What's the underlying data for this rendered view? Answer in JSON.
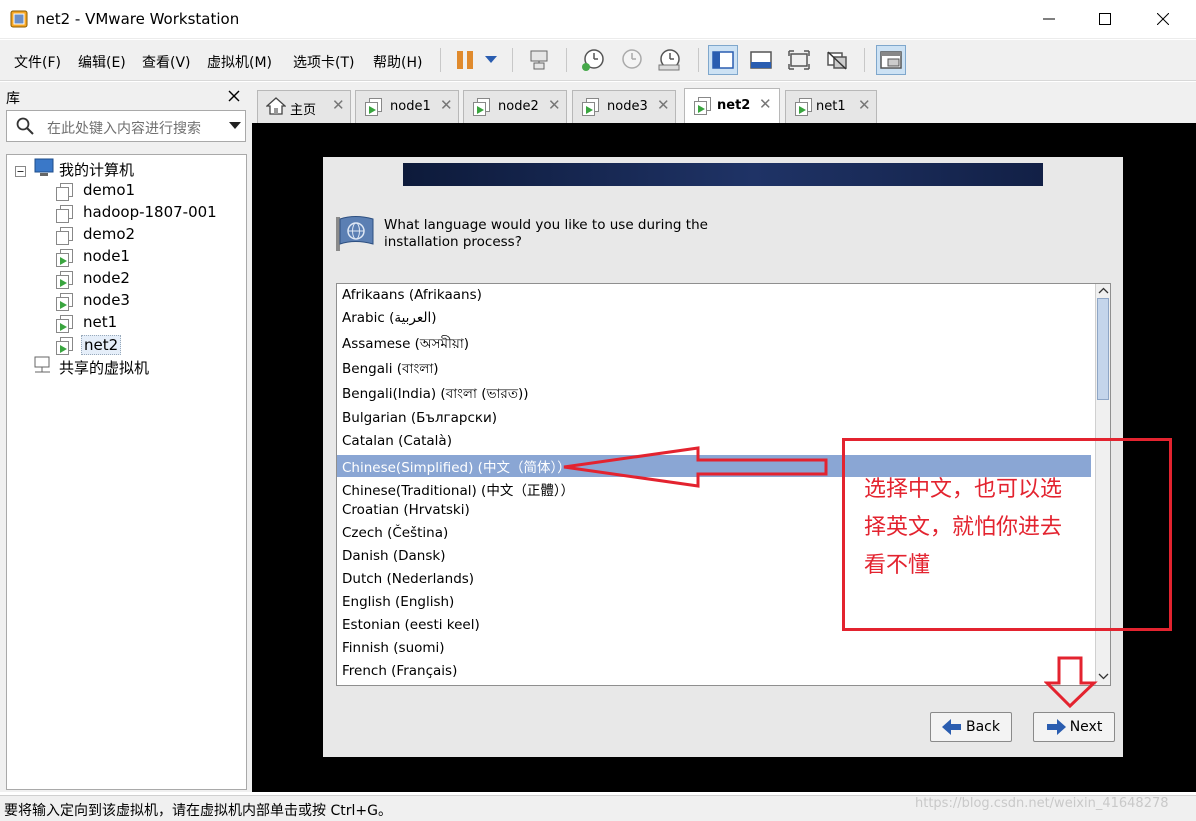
{
  "window": {
    "title": "net2 - VMware Workstation"
  },
  "menu": [
    "文件(F)",
    "编辑(E)",
    "查看(V)",
    "虚拟机(M)",
    "选项卡(T)",
    "帮助(H)"
  ],
  "toolbar_icons": [
    "pause-icon",
    "dropdown-icon",
    "send-keys-icon",
    "snapshot-icon",
    "revert-snapshot-icon",
    "snapshot-manager-icon",
    "show-library-icon",
    "thumbnail-bar-icon",
    "full-screen-icon",
    "unity-icon",
    "console-view-icon"
  ],
  "library": {
    "title": "库",
    "search_placeholder": "在此处键入内容进行搜索",
    "root": "我的计算机",
    "items": [
      "demo1",
      "hadoop-1807-001",
      "demo2",
      "node1",
      "node2",
      "node3",
      "net1",
      "net2"
    ],
    "selected": "net2",
    "shared": "共享的虚拟机"
  },
  "tabs": [
    {
      "label": "主页",
      "active": false
    },
    {
      "label": "node1",
      "active": false
    },
    {
      "label": "node2",
      "active": false
    },
    {
      "label": "node3",
      "active": false
    },
    {
      "label": "net2",
      "active": true
    },
    {
      "label": "net1",
      "active": false
    }
  ],
  "installer": {
    "question_line1": "What language would you like to use during the",
    "question_line2": "installation process?",
    "languages": [
      "Afrikaans (Afrikaans)",
      "Arabic (العربية)",
      "Assamese (অসমীয়া)",
      "Bengali (বাংলা)",
      "Bengali(India) (বাংলা (ভারত))",
      "Bulgarian (Български)",
      "Catalan (Català)",
      "Chinese(Simplified) (中文（简体））",
      "Chinese(Traditional) (中文（正體））",
      "Croatian (Hrvatski)",
      "Czech (Čeština)",
      "Danish (Dansk)",
      "Dutch (Nederlands)",
      "English (English)",
      "Estonian (eesti keel)",
      "Finnish (suomi)",
      "French (Français)"
    ],
    "selected_index": 7,
    "back_label": "Back",
    "next_label": "Next"
  },
  "annotation": {
    "line1": "选择中文，也可以选",
    "line2": "择英文，就怕你进去",
    "line3": "看不懂",
    "color": "#e3232f"
  },
  "status_bar": {
    "text": "要将输入定向到该虚拟机，请在虚拟机内部单击或按 Ctrl+G。"
  },
  "watermark": "https://blog.csdn.net/weixin_41648278"
}
